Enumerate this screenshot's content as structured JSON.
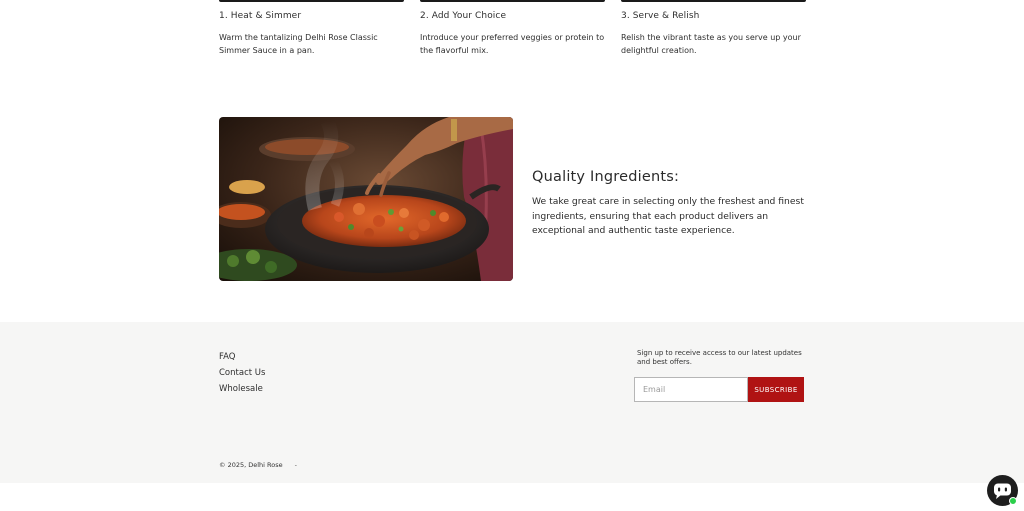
{
  "steps": [
    {
      "title": "1. Heat & Simmer",
      "description": "Warm the tantalizing Delhi Rose Classic Simmer Sauce in a pan."
    },
    {
      "title": "2. Add Your Choice",
      "description": "Introduce your preferred veggies or protein to the flavorful mix."
    },
    {
      "title": "3. Serve & Relish",
      "description": "Relish the vibrant taste as you serve up your delightful creation."
    }
  ],
  "quality": {
    "heading": "Quality Ingredients:",
    "body": "We take great care in selecting only the freshest and finest ingredients, ensuring that each product delivers an exceptional and authentic taste experience."
  },
  "footer": {
    "links": [
      "FAQ",
      "Contact Us",
      "Wholesale"
    ],
    "newsletter_text": "Sign up to receive access to our latest updates and best offers.",
    "email_placeholder": "Email",
    "subscribe_label": "SUBSCRIBE",
    "copyright": "© 2025, Delhi Rose",
    "separator": "-"
  },
  "colors": {
    "accent": "#b01313",
    "footer_bg": "#f6f6f5",
    "chat_bg": "#1e1e1e",
    "online": "#2bcf4b"
  },
  "icons": {
    "chat": "chat-bubble-icon"
  }
}
